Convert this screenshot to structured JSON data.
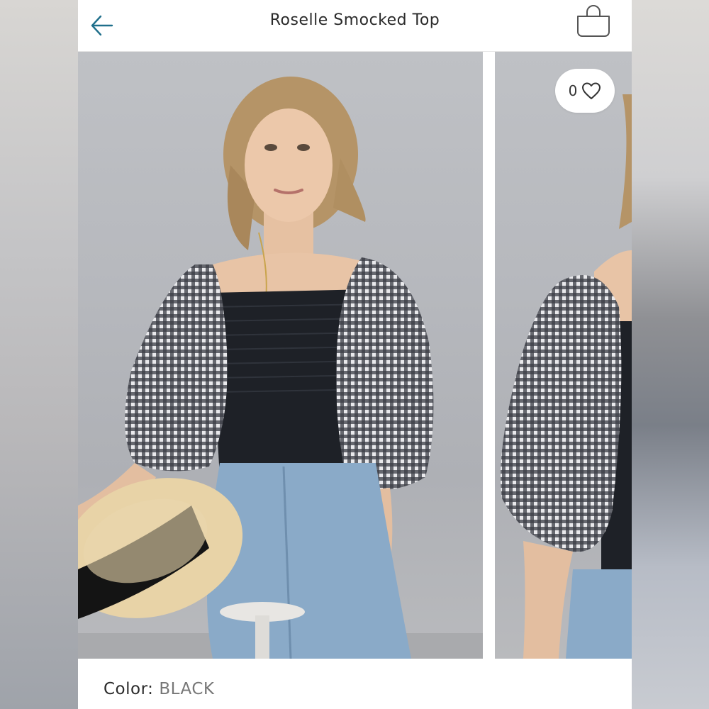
{
  "header": {
    "title": "Roselle Smocked Top",
    "back_icon": "arrow-left-icon",
    "bag_icon": "shopping-bag-icon"
  },
  "product": {
    "favorite_count": "0",
    "favorite_icon": "heart-outline-icon",
    "color_label": "Color:",
    "color_value": "BLACK"
  },
  "colors": {
    "accent": "#1f6f8b",
    "text": "#2b2b2b",
    "muted": "#777777"
  }
}
